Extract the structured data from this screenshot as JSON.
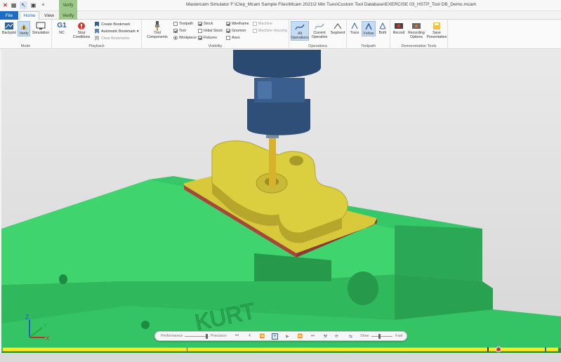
{
  "app": {
    "title": "Mastercam Simulator  F:\\Clep_Mcam Sample Files\\Mcam 2021\\2 Min Tues\\Custom Tool Database\\EXERCISE 03_HSTP_Tool DB_Demo.mcam",
    "context_tab": "Verify"
  },
  "tabs": {
    "file": "File",
    "home": "Home",
    "view": "View",
    "verify": "Verify"
  },
  "ribbon": {
    "mode": {
      "label": "Mode",
      "backplot": "Backplot",
      "verify": "Verify",
      "simulation": "Simulation"
    },
    "playback": {
      "label": "Playback",
      "nc": "NC",
      "g1": "G1",
      "stop_conditions": "Stop Conditions",
      "create_bookmark": "Create Bookmark",
      "automatic_bookmark": "Automatic Bookmark",
      "clear_bookmarks": "Clear Bookmarks"
    },
    "visibility": {
      "label": "Visibility",
      "tool_components": "Tool Components",
      "items": {
        "toolpath": "Toolpath",
        "tool": "Tool",
        "workpiece": "Workpiece",
        "stock": "Stock",
        "initial_stock": "Initial Stock",
        "fixtures": "Fixtures",
        "wireframe": "Wireframe",
        "gnomon": "Gnomon",
        "axes": "Axes",
        "machine": "Machine",
        "machine_housing": "Machine Housing"
      }
    },
    "operations": {
      "label": "Operations",
      "all": "All Operations",
      "current": "Current Operation",
      "segment": "Segment"
    },
    "toolpath": {
      "label": "Toolpath",
      "trace": "Trace",
      "follow": "Follow",
      "both": "Both"
    },
    "demo": {
      "label": "Demonstration Tools",
      "record": "Record",
      "recording_options": "Recording Options",
      "save_presentation": "Save Presentation"
    }
  },
  "viewport": {
    "engraving": "KURT",
    "gnomon": {
      "z": "Z",
      "y": "Y",
      "x": "X"
    }
  },
  "playbar": {
    "performance": "Performance",
    "precision": "Precision",
    "slow": "Slow",
    "fast": "Fast"
  },
  "icons": {
    "quick_access": [
      "mastercam-logo-icon",
      "grid-icon",
      "pointer-icon",
      "monitor-icon",
      "close-icon"
    ],
    "playback_controls": [
      "skip-start-icon",
      "step-back-icon",
      "rewind-icon",
      "play-back-icon",
      "pause-icon",
      "play-icon",
      "fast-forward-icon",
      "skip-end-icon",
      "tool-icon",
      "refresh-icon",
      "loop-icon"
    ]
  },
  "colors": {
    "accent": "#1d6cc4",
    "verify_context": "#9cc88a",
    "fixture_green": "#3fd46e",
    "part_yellow": "#d7c93a",
    "stock_red": "#a7473c",
    "spindle_blue": "#2f4f78",
    "timeline_yellow": "#f2ee2a"
  }
}
